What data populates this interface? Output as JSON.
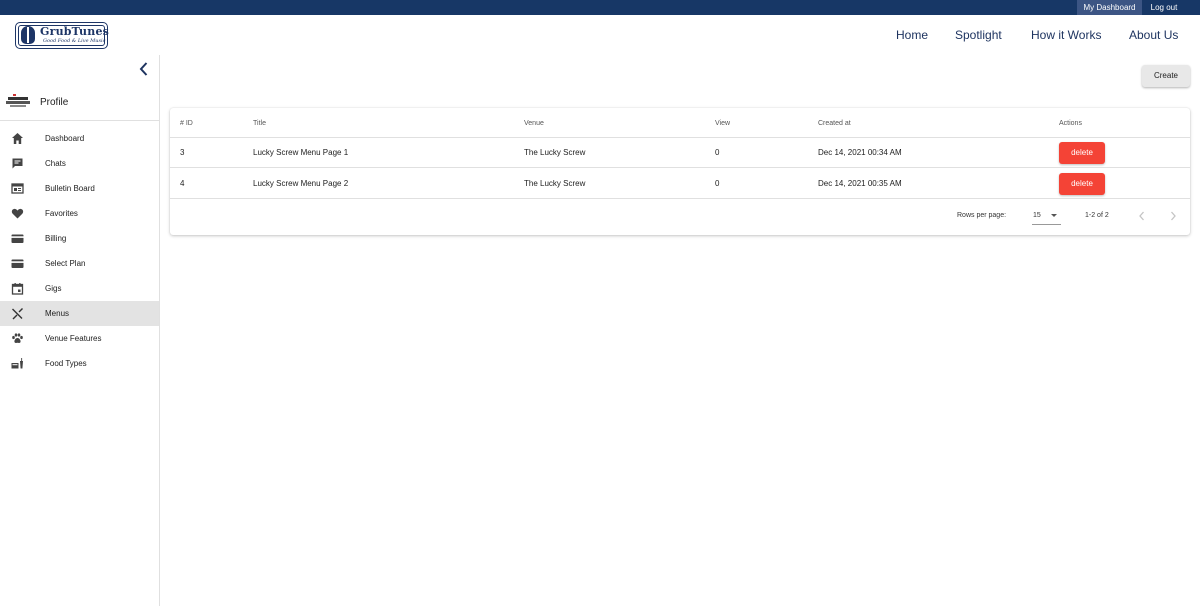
{
  "topbar": {
    "dashboard_label": "My Dashboard",
    "logout_label": "Log out",
    "bg_color": "#173766"
  },
  "header": {
    "logo": {
      "title": "GrubTunes",
      "tagline": "Good Food & Live Music"
    },
    "nav": [
      {
        "label": "Home"
      },
      {
        "label": "Spotlight"
      },
      {
        "label": "How it Works"
      },
      {
        "label": "About Us"
      }
    ]
  },
  "sidebar": {
    "profile_label": "Profile",
    "items": [
      {
        "label": "Dashboard",
        "icon": "home-icon"
      },
      {
        "label": "Chats",
        "icon": "chat-icon"
      },
      {
        "label": "Bulletin Board",
        "icon": "bulletin-board-icon"
      },
      {
        "label": "Favorites",
        "icon": "heart-icon"
      },
      {
        "label": "Billing",
        "icon": "credit-card-icon"
      },
      {
        "label": "Select Plan",
        "icon": "credit-card-icon"
      },
      {
        "label": "Gigs",
        "icon": "calendar-icon"
      },
      {
        "label": "Menus",
        "icon": "utensils-icon",
        "active": true
      },
      {
        "label": "Venue Features",
        "icon": "paw-icon"
      },
      {
        "label": "Food Types",
        "icon": "food-icon"
      }
    ]
  },
  "main": {
    "create_label": "Create",
    "table": {
      "headers": {
        "id": "# ID",
        "title": "Title",
        "venue": "Venue",
        "view": "View",
        "created": "Created at",
        "actions": "Actions"
      },
      "rows": [
        {
          "id": "3",
          "title": "Lucky Screw Menu Page 1",
          "venue": "The Lucky Screw",
          "view": "0",
          "created": "Dec 14, 2021 00:34 AM",
          "action": "delete"
        },
        {
          "id": "4",
          "title": "Lucky Screw Menu Page 2",
          "venue": "The Lucky Screw",
          "view": "0",
          "created": "Dec 14, 2021 00:35 AM",
          "action": "delete"
        }
      ]
    },
    "pagination": {
      "rows_per_page_label": "Rows per page:",
      "rows_per_page": "15",
      "range": "1-2 of 2"
    },
    "colors": {
      "delete": "#f44336",
      "active_item": "#e3e3e3"
    }
  }
}
